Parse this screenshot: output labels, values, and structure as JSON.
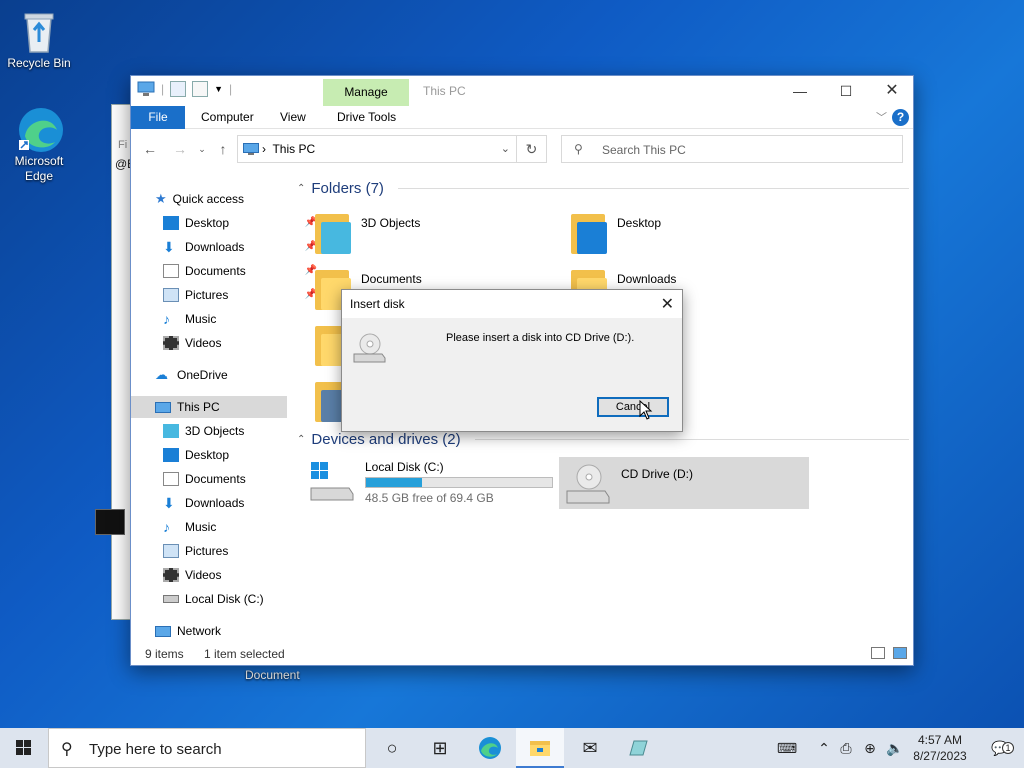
{
  "desktop": {
    "icons": [
      {
        "label": "Recycle Bin"
      },
      {
        "label": "Microsoft Edge"
      }
    ],
    "stray_label": "Document"
  },
  "explorer": {
    "title": "This PC",
    "manage_tab": "Manage",
    "ribbon_tabs": {
      "file": "File",
      "computer": "Computer",
      "view": "View",
      "drive_tools": "Drive Tools"
    },
    "address": {
      "crumb": "This PC"
    },
    "search": {
      "placeholder": "Search This PC"
    },
    "sidebar": {
      "quick_access": "Quick access",
      "quick_items": [
        {
          "label": "Desktop"
        },
        {
          "label": "Downloads"
        },
        {
          "label": "Documents"
        },
        {
          "label": "Pictures"
        },
        {
          "label": "Music"
        },
        {
          "label": "Videos"
        }
      ],
      "onedrive": "OneDrive",
      "this_pc": "This PC",
      "pc_items": [
        {
          "label": "3D Objects"
        },
        {
          "label": "Desktop"
        },
        {
          "label": "Documents"
        },
        {
          "label": "Downloads"
        },
        {
          "label": "Music"
        },
        {
          "label": "Pictures"
        },
        {
          "label": "Videos"
        },
        {
          "label": "Local Disk (C:)"
        }
      ],
      "network": "Network"
    },
    "folders_header": "Folders (7)",
    "folders": [
      {
        "name": "3D Objects"
      },
      {
        "name": "Desktop"
      },
      {
        "name": "Documents"
      },
      {
        "name": "Downloads"
      }
    ],
    "drives_header": "Devices and drives (2)",
    "drives": [
      {
        "name": "Local Disk (C:)",
        "free_text": "48.5 GB free of 69.4 GB",
        "used_fraction": 0.3
      },
      {
        "name": "CD Drive (D:)"
      }
    ],
    "status": {
      "items": "9 items",
      "selected": "1 item selected"
    }
  },
  "dialog": {
    "title": "Insert disk",
    "message": "Please insert a disk into CD Drive (D:).",
    "cancel": "Cancel"
  },
  "taskbar": {
    "search_placeholder": "Type here to search",
    "time": "4:57 AM",
    "date": "8/27/2023",
    "notification_count": "1"
  },
  "colors": {
    "accent": "#1a6fc9",
    "manage_tab": "#c7ecb2",
    "folder": "#ffd86b",
    "usage": "#26a0da"
  }
}
